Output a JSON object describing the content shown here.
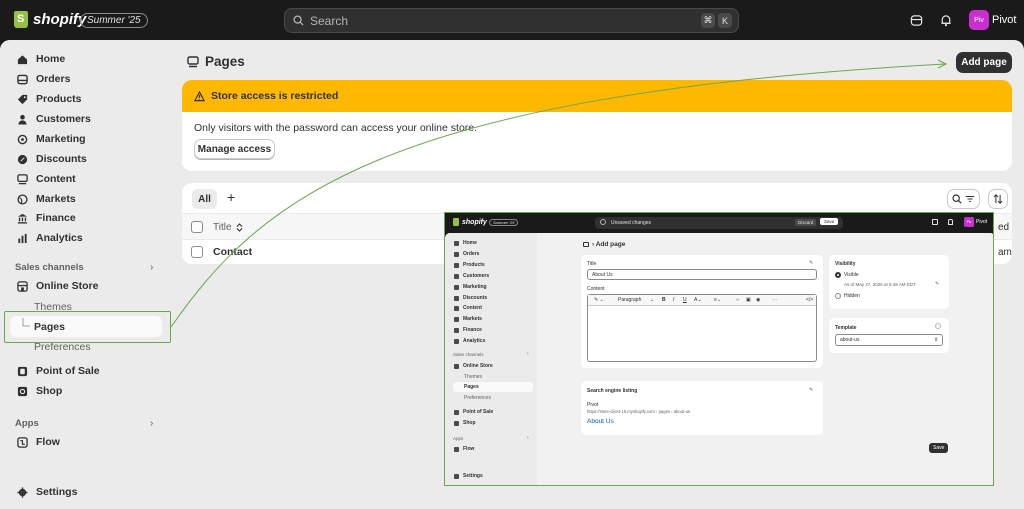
{
  "topbar": {
    "logo_text": "shopify",
    "edition_badge": "Summer '25",
    "search_placeholder": "Search",
    "shortcut_key1": "⌘",
    "shortcut_key2": "K",
    "avatar_initials": "Piv",
    "store_name": "Pivot"
  },
  "sidebar": {
    "items": [
      {
        "label": "Home",
        "icon": "home-icon"
      },
      {
        "label": "Orders",
        "icon": "orders-icon"
      },
      {
        "label": "Products",
        "icon": "tag-icon"
      },
      {
        "label": "Customers",
        "icon": "person-icon"
      },
      {
        "label": "Marketing",
        "icon": "target-icon"
      },
      {
        "label": "Discounts",
        "icon": "discount-icon"
      },
      {
        "label": "Content",
        "icon": "content-icon"
      },
      {
        "label": "Markets",
        "icon": "globe-icon"
      },
      {
        "label": "Finance",
        "icon": "bank-icon"
      },
      {
        "label": "Analytics",
        "icon": "bar-chart-icon"
      }
    ],
    "sales_channels_label": "Sales channels",
    "online_store": "Online Store",
    "online_store_sub": [
      "Themes",
      "Pages",
      "Preferences"
    ],
    "point_of_sale": "Point of Sale",
    "shop": "Shop",
    "apps_label": "Apps",
    "flow": "Flow",
    "settings": "Settings"
  },
  "main": {
    "page_title": "Pages",
    "add_button": "Add page",
    "banner_title": "Store access is restricted",
    "banner_body": "Only visitors with the password can access your online store.",
    "manage_button": "Manage access",
    "tab_all": "All",
    "tab_add": "+",
    "col_title": "Title",
    "row1": "Contact",
    "col_updated_fragment": "ed",
    "row1_updated_fragment": "am"
  },
  "overlay": {
    "logo_text": "shopify",
    "edition_badge": "Summer '25",
    "unsaved": "Unsaved changes",
    "discard": "Discard",
    "save": "Save",
    "store_name": "Pivot",
    "avatar_initials": "Piv",
    "nav": [
      "Home",
      "Orders",
      "Products",
      "Customers",
      "Marketing",
      "Discounts",
      "Content",
      "Markets",
      "Finance",
      "Analytics"
    ],
    "sales_channels_label": "Sales channels",
    "online_store": "Online Store",
    "sub": [
      "Themes",
      "Pages",
      "Preferences"
    ],
    "point_of_sale": "Point of Sale",
    "shop": "Shop",
    "apps_label": "Apps",
    "flow": "Flow",
    "settings": "Settings",
    "breadcrumb": "› Add page",
    "title_label": "Title",
    "title_value": "About Us",
    "content_label": "Content",
    "paragraph": "Paragraph",
    "visibility_label": "Visibility",
    "visible": "Visible",
    "visible_date": "As of May 27, 2025 at 5:49 AM EDT",
    "hidden": "Hidden",
    "template_label": "Template",
    "template_value": "about-us",
    "seo_label": "Search engine listing",
    "seo_store": "Pivot",
    "seo_url": "https://store-client-19.myshopify.com › pages › about-us",
    "seo_title": "About Us",
    "save_bottom": "Save"
  },
  "colors": {
    "banner": "#ffb800",
    "highlight": "#6aa84f",
    "avatar": "#c82fd1",
    "link": "#005bd3"
  }
}
